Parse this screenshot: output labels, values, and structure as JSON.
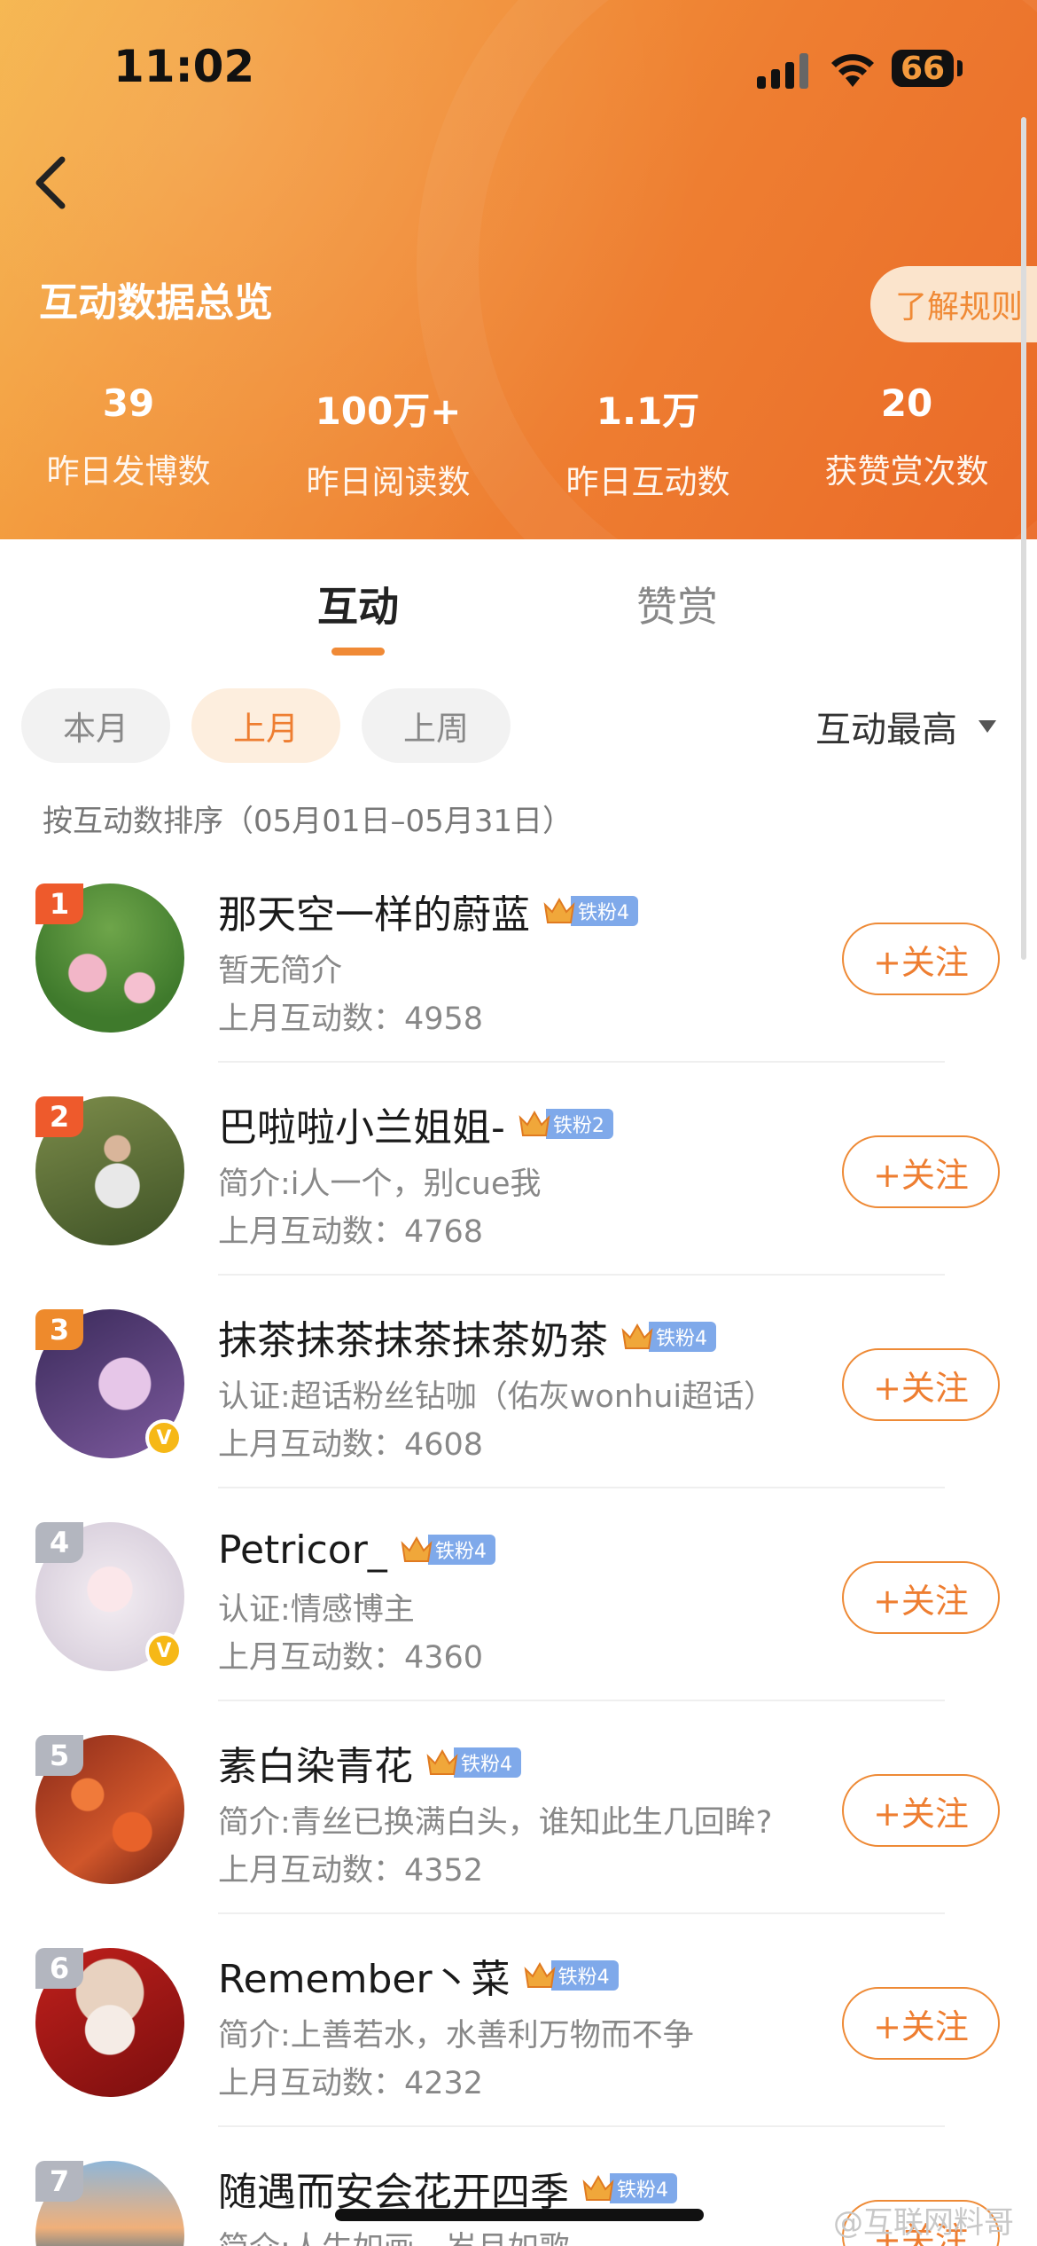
{
  "status_bar": {
    "time": "11:02",
    "battery": "66"
  },
  "header": {
    "title": "互动数据总览",
    "rules_label": "了解规则",
    "stats": [
      {
        "value": "39",
        "label": "昨日发博数"
      },
      {
        "value": "100万+",
        "label": "昨日阅读数"
      },
      {
        "value": "1.1万",
        "label": "昨日互动数"
      },
      {
        "value": "20",
        "label": "获赞赏次数"
      }
    ]
  },
  "tabs": [
    {
      "label": "互动",
      "active": true
    },
    {
      "label": "赞赏",
      "active": false
    }
  ],
  "filters": {
    "chips": [
      {
        "label": "本月",
        "active": false
      },
      {
        "label": "上月",
        "active": true
      },
      {
        "label": "上周",
        "active": false
      }
    ],
    "sort_label": "互动最高",
    "range_text": "按互动数排序（05月01日–05月31日）"
  },
  "list": [
    {
      "rank": "1",
      "name": "那天空一样的蔚蓝",
      "badge": "铁粉4",
      "bio": "暂无简介",
      "count": "上月互动数：4958",
      "follow": "+关注",
      "verified": false
    },
    {
      "rank": "2",
      "name": "巴啦啦小兰姐姐-",
      "badge": "铁粉2",
      "bio": "简介:i人一个，别cue我",
      "count": "上月互动数：4768",
      "follow": "+关注",
      "verified": false
    },
    {
      "rank": "3",
      "name": "抹茶抹茶抹茶抹茶奶茶",
      "badge": "铁粉4",
      "bio": "认证:超话粉丝钻咖（佑灰wonhui超话）",
      "count": "上月互动数：4608",
      "follow": "+关注",
      "verified": true
    },
    {
      "rank": "4",
      "name": "Petricor_",
      "badge": "铁粉4",
      "bio": "认证:情感博主",
      "count": "上月互动数：4360",
      "follow": "+关注",
      "verified": true
    },
    {
      "rank": "5",
      "name": "素白染青花",
      "badge": "铁粉4",
      "bio": "简介:青丝已换满白头，谁知此生几回眸?",
      "count": "上月互动数：4352",
      "follow": "+关注",
      "verified": false
    },
    {
      "rank": "6",
      "name": "Remember丶菜",
      "badge": "铁粉4",
      "bio": "简介:上善若水，水善利万物而不争",
      "count": "上月互动数：4232",
      "follow": "+关注",
      "verified": false
    },
    {
      "rank": "7",
      "name": "随遇而安会花开四季",
      "badge": "铁粉4",
      "bio": "简介:人生如画，岁月如歌",
      "count": "",
      "follow": "+关注",
      "verified": false
    }
  ],
  "watermark": "@互联网料哥",
  "colors": {
    "accent": "#ee7e31",
    "badge": "#7fa9ea",
    "rank_top": "#ee5a2c",
    "rank_normal": "#b3b6bf"
  }
}
